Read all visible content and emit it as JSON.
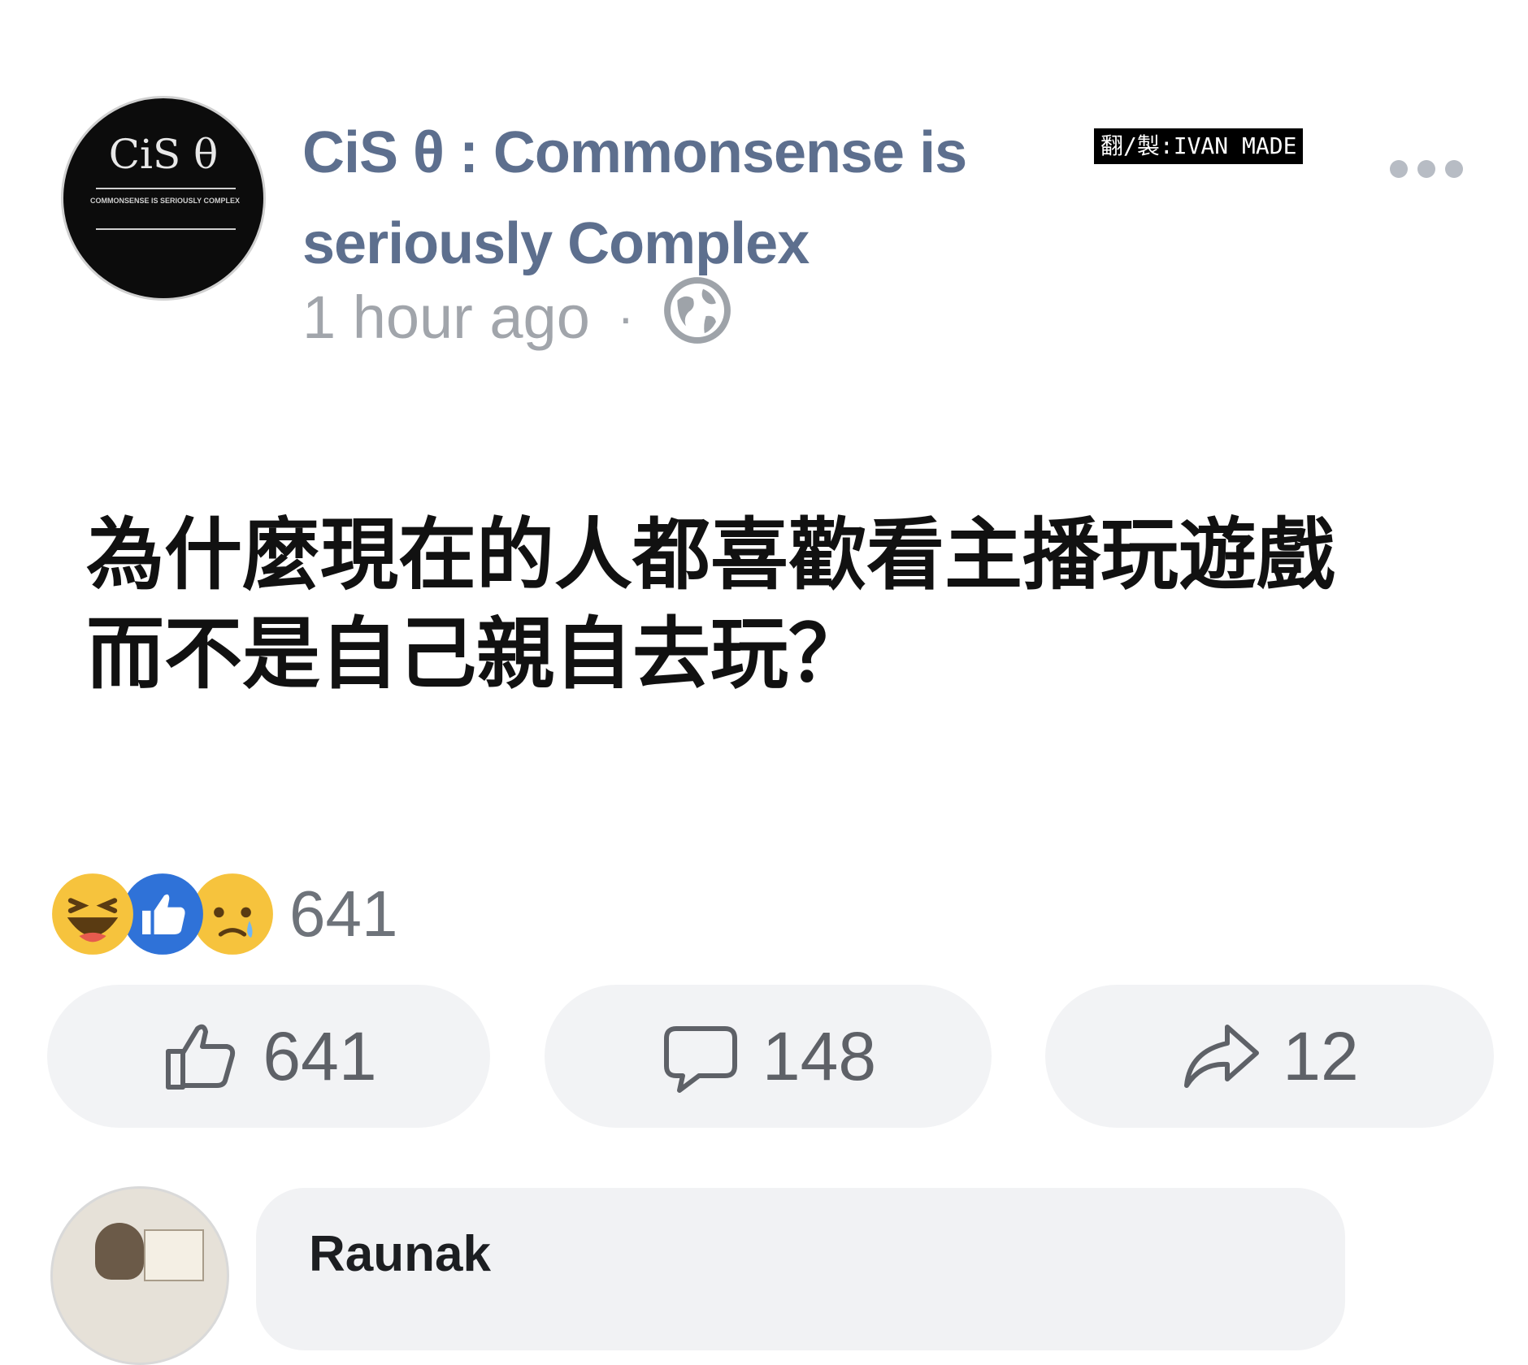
{
  "post": {
    "page_name": "CiS θ  : Commonsense is seriously Complex",
    "timestamp": "1 hour ago",
    "separator": "·",
    "privacy_icon": "globe-icon",
    "more_icon": "more-dots-icon",
    "watermark": "翻/製:IVAN MADE",
    "avatar_logo_text": "CiS θ",
    "avatar_tagline": "COMMONSENSE IS SERIOUSLY COMPLEX",
    "text_line1": "為什麼現在的人都喜歡看主播玩遊戲",
    "text_line2": "而不是自己親自去玩？"
  },
  "reactions": {
    "icons": [
      "haha-icon",
      "like-icon",
      "sad-icon"
    ],
    "count": "641"
  },
  "actions": [
    {
      "icon": "thumbs-up-icon",
      "count": "641"
    },
    {
      "icon": "comment-icon",
      "count": "148"
    },
    {
      "icon": "share-icon",
      "count": "12"
    }
  ],
  "comment": {
    "author": "Raunak"
  },
  "colors": {
    "page_name": "#5d6f8e",
    "meta_text": "#a1a5ab",
    "button_bg": "#f2f3f5",
    "like_blue": "#2f72d8",
    "emoji_yellow": "#f6c33d"
  }
}
